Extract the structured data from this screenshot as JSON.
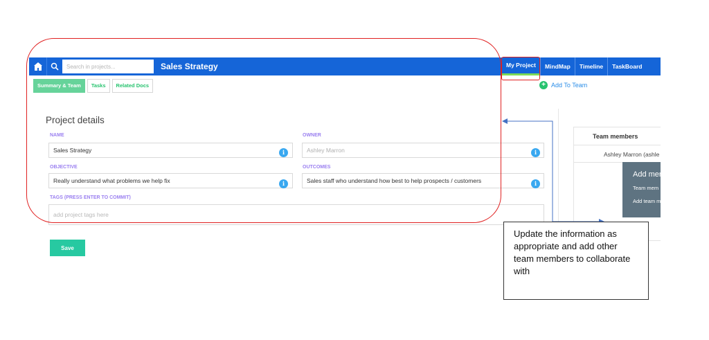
{
  "header": {
    "search_placeholder": "Search in projects...",
    "project_title": "Sales Strategy",
    "nav_tabs": [
      {
        "label": "My Project"
      },
      {
        "label": "MindMap"
      },
      {
        "label": "Timeline"
      },
      {
        "label": "TaskBoard"
      }
    ]
  },
  "subtabs": [
    {
      "label": "Summary & Team"
    },
    {
      "label": "Tasks"
    },
    {
      "label": "Related Docs"
    }
  ],
  "add_to_team": "Add To Team",
  "project_details": {
    "title": "Project details",
    "name_label": "NAME",
    "name_value": "Sales Strategy",
    "owner_label": "OWNER",
    "owner_value": "Ashley Marron",
    "objective_label": "OBJECTIVE",
    "objective_value": "Really understand what problems we help fix",
    "outcomes_label": "OUTCOMES",
    "outcomes_value": "Sales staff who understand how best to help prospects / customers",
    "tags_label": "TAGS (PRESS ENTER TO COMMIT)",
    "tags_placeholder": "add project tags here",
    "info_glyph": "i"
  },
  "save_label": "Save",
  "team": {
    "header": "Team members",
    "member": "Ashley Marron (ashle",
    "popup_title": "Add mem",
    "popup_line1": "Team mem",
    "popup_line2": "Add team m"
  },
  "annotation": {
    "text": "Update the information as appropriate and add other team members to collaborate with"
  },
  "colors": {
    "topbar": "#1565d8",
    "accent_green": "#27c36f",
    "annotation_red": "#e02020",
    "arrow_blue": "#4472c4"
  }
}
